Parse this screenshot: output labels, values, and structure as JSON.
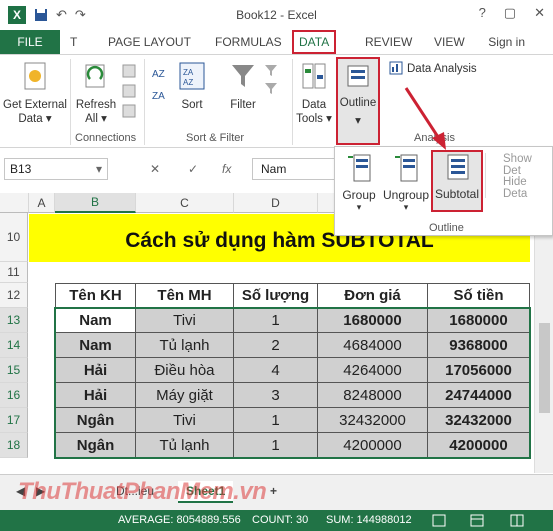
{
  "window": {
    "title": "Book12 - Excel",
    "min": "?",
    "restore": "▢",
    "close": "✕"
  },
  "qat": {
    "save_icon": "save-icon",
    "undo": "↶",
    "redo": "↷"
  },
  "tabs": {
    "file": "FILE",
    "t": "T",
    "page_layout": "PAGE LAYOUT",
    "formulas": "FORMULAS",
    "data": "DATA",
    "review": "REVIEW",
    "view": "VIEW",
    "signin": "Sign in"
  },
  "ribbon": {
    "get_external": "Get External",
    "get_external2": "Data ▾",
    "refresh": "Refresh",
    "refresh2": "All ▾",
    "connections": "Connections",
    "sort": "Sort",
    "filter": "Filter",
    "sort_filter": "Sort & Filter",
    "data_tools": "Data",
    "data_tools2": "Tools ▾",
    "outline": "Outline",
    "outline_caret": "▾",
    "data_analysis": "Data Analysis",
    "analysis": "Analysis"
  },
  "formula_bar": {
    "namebox": "B13",
    "cancel": "✕",
    "enter": "✓",
    "fx": "fx",
    "value": "Nam"
  },
  "dropdown": {
    "group": "Group",
    "ungroup": "Ungroup",
    "subtotal": "Subtotal",
    "show_detail": "Show Det",
    "hide_detail": "Hide Deta",
    "outline": "Outline"
  },
  "columns": [
    "A",
    "B",
    "C",
    "D",
    "E",
    "F"
  ],
  "rows": [
    "10",
    "11",
    "12",
    "13",
    "14",
    "15",
    "16",
    "17",
    "18"
  ],
  "sheet_title": "Cách sử dụng hàm SUBTOTAL",
  "table": {
    "headers": [
      "Tên KH",
      "Tên MH",
      "Số lượng",
      "Đơn giá",
      "Số tiền"
    ],
    "rows": [
      [
        "Nam",
        "Tivi",
        "1",
        "1680000",
        "1680000"
      ],
      [
        "Nam",
        "Tủ lạnh",
        "2",
        "4684000",
        "9368000"
      ],
      [
        "Hải",
        "Điều hòa",
        "4",
        "4264000",
        "17056000"
      ],
      [
        "Hải",
        "Máy giặt",
        "3",
        "8248000",
        "24744000"
      ],
      [
        "Ngân",
        "Tivi",
        "1",
        "32432000",
        "32432000"
      ],
      [
        "Ngân",
        "Tủ lạnh",
        "1",
        "4200000",
        "4200000"
      ]
    ]
  },
  "sheets": {
    "prev": "◀",
    "next": "▶",
    "tab1": "Dt...ieu",
    "active": "Sheet1",
    "add": "+"
  },
  "status": {
    "average": "AVERAGE: 8054889.556",
    "count": "COUNT: 30",
    "sum": "SUM: 144988012"
  },
  "watermark": "ThuThuatPhanMem.vn",
  "colors": {
    "excel_green": "#217346",
    "title_fill": "#ffff00",
    "highlight": "#cc2233"
  }
}
